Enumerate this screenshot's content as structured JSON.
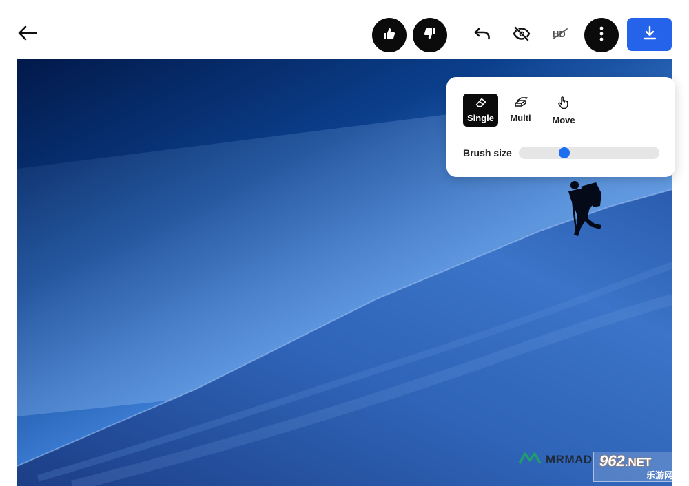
{
  "toolbar": {
    "back_icon": "arrow-left-icon",
    "like_icon": "thumbs-up-icon",
    "dislike_icon": "thumbs-down-icon",
    "undo_icon": "undo-icon",
    "hide_icon": "eye-off-icon",
    "hd_icon": "hd-off-icon",
    "more_icon": "more-vertical-icon",
    "download_icon": "download-icon",
    "accent_color": "#2563eb"
  },
  "tool_panel": {
    "modes": [
      {
        "label": "Single",
        "icon": "eraser-icon",
        "active": true
      },
      {
        "label": "Multi",
        "icon": "stacked-erasers-icon",
        "active": false
      },
      {
        "label": "Move",
        "icon": "hand-pointer-icon",
        "active": false
      }
    ],
    "brush_size_label": "Brush size",
    "brush_size_value": 0.31,
    "slider_color": "#1e6ff0"
  },
  "watermarks": {
    "left_text": "MRMAD",
    "right_number": "962",
    "right_suffix": ".NET",
    "right_sub": "乐游网"
  }
}
